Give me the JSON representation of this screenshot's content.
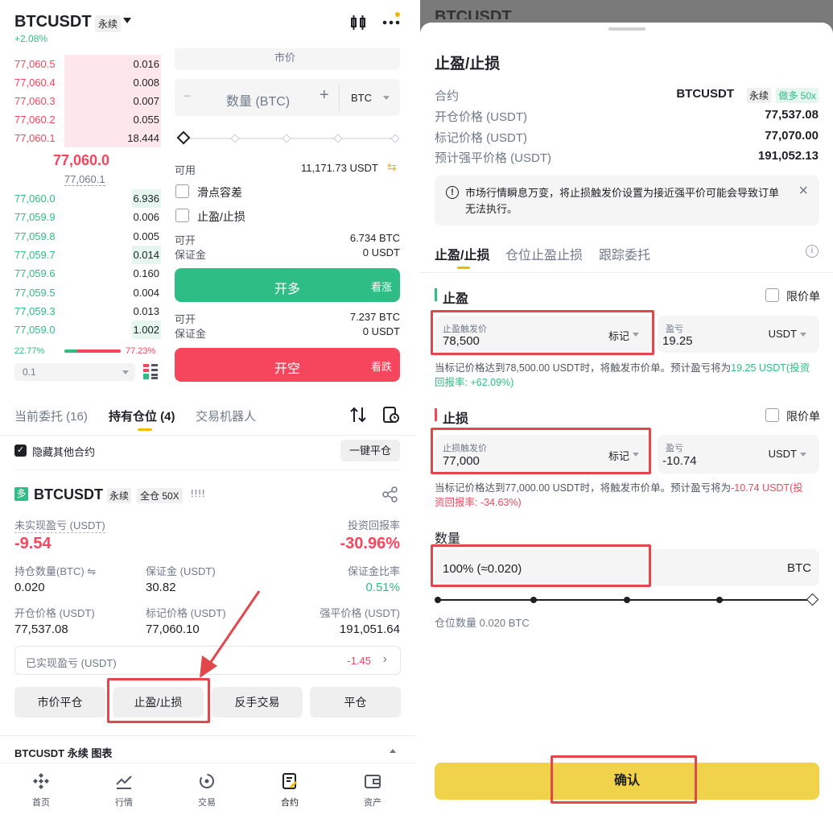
{
  "left": {
    "header": {
      "symbol": "BTCUSDT",
      "type_badge": "永续",
      "change": "+2.08%"
    },
    "orderbook": {
      "asks": [
        {
          "price": "77,060.5",
          "qty": "0.016"
        },
        {
          "price": "77,060.4",
          "qty": "0.008"
        },
        {
          "price": "77,060.3",
          "qty": "0.007"
        },
        {
          "price": "77,060.2",
          "qty": "0.055"
        },
        {
          "price": "77,060.1",
          "qty": "18.444"
        }
      ],
      "last_price": "77,060.0",
      "mark_price": "77,060.1",
      "bids": [
        {
          "price": "77,060.0",
          "qty": "6.936"
        },
        {
          "price": "77,059.9",
          "qty": "0.006"
        },
        {
          "price": "77,059.8",
          "qty": "0.005"
        },
        {
          "price": "77,059.7",
          "qty": "0.014"
        },
        {
          "price": "77,059.6",
          "qty": "0.160"
        },
        {
          "price": "77,059.5",
          "qty": "0.004"
        },
        {
          "price": "77,059.3",
          "qty": "0.013"
        },
        {
          "price": "77,059.0",
          "qty": "1.002"
        }
      ],
      "buy_ratio": "22.77%",
      "sell_ratio": "77.23%",
      "buy_ratio_value": 0.2277,
      "precision": "0.1"
    },
    "order_form": {
      "market_placeholder": "市价",
      "qty_placeholder": "数量 (BTC)",
      "qty_unit": "BTC",
      "available_label": "可用",
      "available_value": "11,171.73 USDT",
      "slippage_label": "滑点容差",
      "tpsl_label": "止盈/止损",
      "long_open_label": "可开",
      "long_open_value": "6.734 BTC",
      "long_margin_label": "保证金",
      "long_margin_value": "0 USDT",
      "long_btn": "开多",
      "long_btn_sub": "看涨",
      "short_open_label": "可开",
      "short_open_value": "7.237 BTC",
      "short_margin_label": "保证金",
      "short_margin_value": "0 USDT",
      "short_btn": "开空",
      "short_btn_sub": "看跌"
    },
    "tabs": [
      "当前委托 (16)",
      "持有仓位 (4)",
      "交易机器人"
    ],
    "hide_others_label": "隐藏其他合约",
    "close_all_btn": "一键平仓",
    "position": {
      "side_badge": "多",
      "symbol": "BTCUSDT",
      "type": "永续",
      "margin_mode": "全仓 50X",
      "bars": "!!!!",
      "upnl_label": "未实现盈亏 (USDT)",
      "upnl_value": "-9.54",
      "roi_label": "投资回报率",
      "roi_value": "-30.96%",
      "size_label": "持仓数量(BTC)",
      "size_value": "0.020",
      "margin_label": "保证金 (USDT)",
      "margin_value": "30.82",
      "margin_ratio_label": "保证金比率",
      "margin_ratio_value": "0.51%",
      "entry_label": "开仓价格 (USDT)",
      "entry_value": "77,537.08",
      "mark_label": "标记价格 (USDT)",
      "mark_value": "77,060.10",
      "liq_label": "强平价格 (USDT)",
      "liq_value": "191,051.64",
      "realized_label": "已实现盈亏 (USDT)",
      "realized_value": "-1.45",
      "buttons": [
        "市价平仓",
        "止盈/止损",
        "反手交易",
        "平仓"
      ]
    },
    "chart_row_label": "BTCUSDT 永续 图表",
    "bottom_nav": [
      "首页",
      "行情",
      "交易",
      "合约",
      "资产"
    ],
    "bottom_nav_active": "合约"
  },
  "right": {
    "bg_header": {
      "symbol": "BTCUSDT"
    },
    "sheet": {
      "title": "止盈/止损",
      "contract_label": "合约",
      "contract_symbol": "BTCUSDT",
      "contract_type": "永续",
      "contract_side": "做多 50x",
      "entry_label": "开仓价格 (USDT)",
      "entry_value": "77,537.08",
      "mark_label": "标记价格 (USDT)",
      "mark_value": "77,070.00",
      "liq_label": "预计强平价格 (USDT)",
      "liq_value": "191,052.13",
      "warning": "市场行情瞬息万变，将止损触发价设置为接近强平价可能会导致订单无法执行。",
      "tabs": [
        "止盈/止损",
        "仓位止盈止损",
        "跟踪委托"
      ],
      "tp": {
        "title": "止盈",
        "limit_label": "限价单",
        "trigger_label": "止盈触发价",
        "trigger_value": "78,500",
        "trigger_type": "标记",
        "pnl_label": "盈亏",
        "pnl_value": "19.25",
        "pnl_unit": "USDT",
        "desc_prefix": "当标记价格达到78,500.00 USDT时，将触发市价单。预计盈亏将为",
        "desc_value": "19.25 USDT(投资回报率: +62.09%)"
      },
      "sl": {
        "title": "止损",
        "limit_label": "限价单",
        "trigger_label": "止损触发价",
        "trigger_value": "77,000",
        "trigger_type": "标记",
        "pnl_label": "盈亏",
        "pnl_value": "-10.74",
        "pnl_unit": "USDT",
        "desc_prefix": "当标记价格达到77,000.00 USDT时，将触发市价单。预计盈亏将为",
        "desc_value": "-10.74 USDT(投资回报率: -34.63%)"
      },
      "qty_label": "数量",
      "qty_value": "100% (≈0.020)",
      "qty_unit": "BTC",
      "qty_percent": 1.0,
      "position_size": "仓位数量 0.020 BTC",
      "confirm": "确认"
    }
  },
  "colors": {
    "green": "#2ebd85",
    "red": "#f6465d",
    "yellow": "#f0d24b",
    "annotation": "#e2474b"
  }
}
